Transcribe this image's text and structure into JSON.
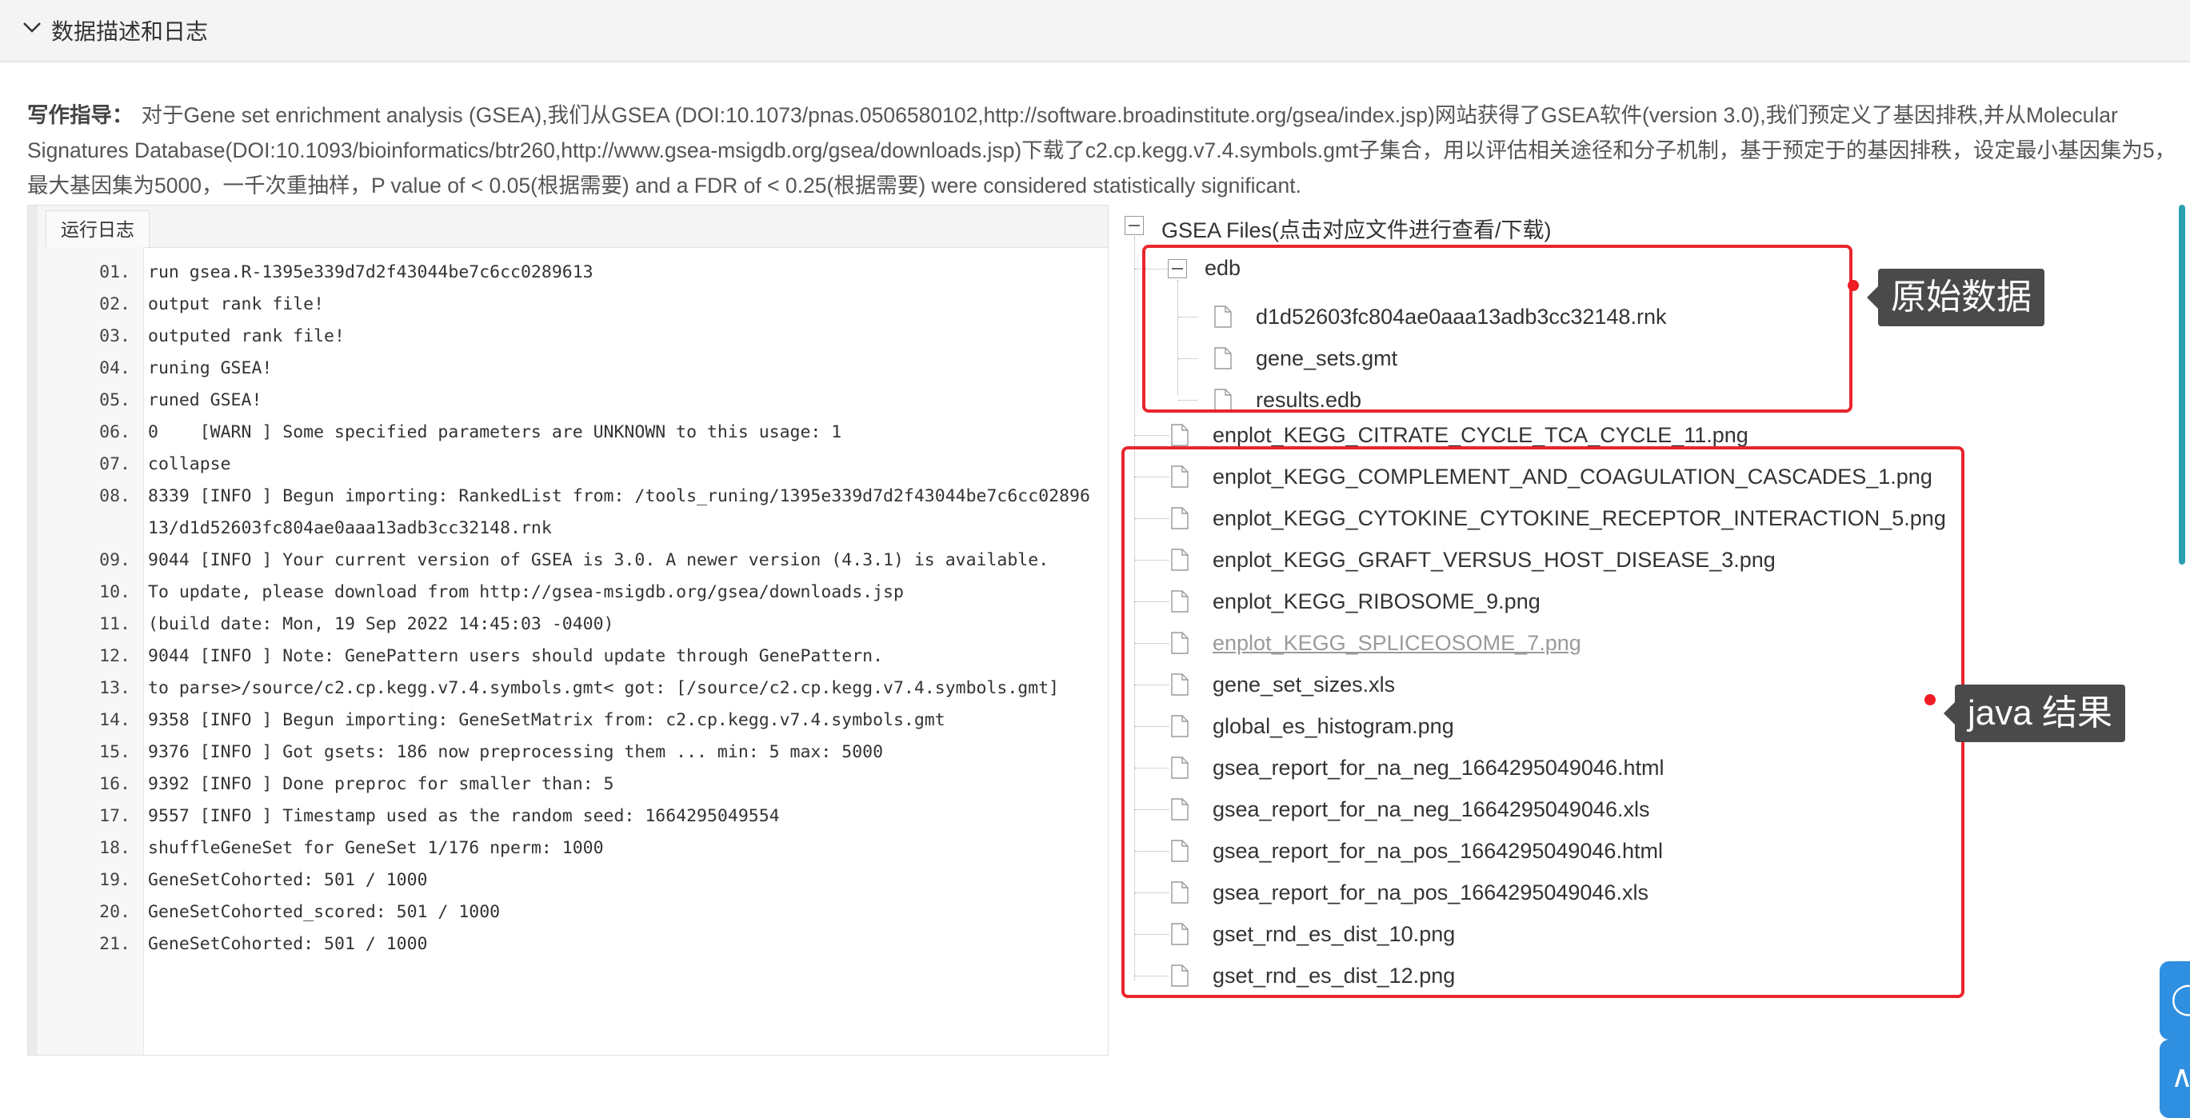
{
  "section": {
    "title": "数据描述和日志"
  },
  "guide": {
    "label": "写作指导：",
    "text": "对于Gene set enrichment analysis (GSEA),我们从GSEA (DOI:10.1073/pnas.0506580102,http://software.broadinstitute.org/gsea/index.jsp)网站获得了GSEA软件(version 3.0),我们预定义了基因排秩,并从Molecular Signatures Database(DOI:10.1093/bioinformatics/btr260,http://www.gsea-msigdb.org/gsea/downloads.jsp)下载了c2.cp.kegg.v7.4.symbols.gmt子集合，用以评估相关途径和分子机制，基于预定于的基因排秩，设定最小基因集为5，最大基因集为5000，一千次重抽样，P value of < 0.05(根据需要) and a FDR of < 0.25(根据需要) were considered statistically significant."
  },
  "log": {
    "tab": "运行日志",
    "lines": [
      {
        "n": "01.",
        "t": "run gsea.R-1395e339d7d2f43044be7c6cc0289613"
      },
      {
        "n": "02.",
        "t": "output rank file!"
      },
      {
        "n": "03.",
        "t": "outputed rank file!"
      },
      {
        "n": "04.",
        "t": "runing GSEA!"
      },
      {
        "n": "05.",
        "t": "runed GSEA!"
      },
      {
        "n": "06.",
        "t": "0    [WARN ] Some specified parameters are UNKNOWN to this usage: 1"
      },
      {
        "n": "07.",
        "t": "collapse"
      },
      {
        "n": "08.",
        "t": "8339 [INFO ] Begun importing: RankedList from: /tools_runing/1395e339d7d2f43044be7c6cc0289613/d1d52603fc804ae0aaa13adb3cc32148.rnk"
      },
      {
        "n": "09.",
        "t": "9044 [INFO ] Your current version of GSEA is 3.0. A newer version (4.3.1) is available."
      },
      {
        "n": "10.",
        "t": "To update, please download from http://gsea-msigdb.org/gsea/downloads.jsp"
      },
      {
        "n": "11.",
        "t": "(build date: Mon, 19 Sep 2022 14:45:03 -0400)"
      },
      {
        "n": "12.",
        "t": "9044 [INFO ] Note: GenePattern users should update through GenePattern."
      },
      {
        "n": "13.",
        "t": "to parse>/source/c2.cp.kegg.v7.4.symbols.gmt< got: [/source/c2.cp.kegg.v7.4.symbols.gmt]"
      },
      {
        "n": "14.",
        "t": "9358 [INFO ] Begun importing: GeneSetMatrix from: c2.cp.kegg.v7.4.symbols.gmt"
      },
      {
        "n": "15.",
        "t": "9376 [INFO ] Got gsets: 186 now preprocessing them ... min: 5 max: 5000"
      },
      {
        "n": "16.",
        "t": "9392 [INFO ] Done preproc for smaller than: 5"
      },
      {
        "n": "17.",
        "t": "9557 [INFO ] Timestamp used as the random seed: 1664295049554"
      },
      {
        "n": "18.",
        "t": "shuffleGeneSet for GeneSet 1/176 nperm: 1000"
      },
      {
        "n": "19.",
        "t": "GeneSetCohorted: 501 / 1000"
      },
      {
        "n": "20.",
        "t": "GeneSetCohorted_scored: 501 / 1000"
      },
      {
        "n": "21.",
        "t": "GeneSetCohorted: 501 / 1000"
      }
    ]
  },
  "tree": {
    "root": "GSEA Files(点击对应文件进行查看/下载)",
    "folder": "edb",
    "edb_files": [
      "d1d52603fc804ae0aaa13adb3cc32148.rnk",
      "gene_sets.gmt",
      "results.edb"
    ],
    "files": [
      "enplot_KEGG_CITRATE_CYCLE_TCA_CYCLE_11.png",
      "enplot_KEGG_COMPLEMENT_AND_COAGULATION_CASCADES_1.png",
      "enplot_KEGG_CYTOKINE_CYTOKINE_RECEPTOR_INTERACTION_5.png",
      "enplot_KEGG_GRAFT_VERSUS_HOST_DISEASE_3.png",
      "enplot_KEGG_RIBOSOME_9.png",
      "enplot_KEGG_SPLICEOSOME_7.png",
      "gene_set_sizes.xls",
      "global_es_histogram.png",
      "gsea_report_for_na_neg_1664295049046.html",
      "gsea_report_for_na_neg_1664295049046.xls",
      "gsea_report_for_na_pos_1664295049046.html",
      "gsea_report_for_na_pos_1664295049046.xls",
      "gset_rnd_es_dist_10.png",
      "gset_rnd_es_dist_12.png"
    ]
  },
  "annotations": {
    "raw_data": "原始数据",
    "java_results": "java 结果",
    "highlight_color": "#e8262c"
  },
  "float_buttons": {
    "top_icon": "chat-icon",
    "bottom_icon": "arrow-up-icon"
  }
}
